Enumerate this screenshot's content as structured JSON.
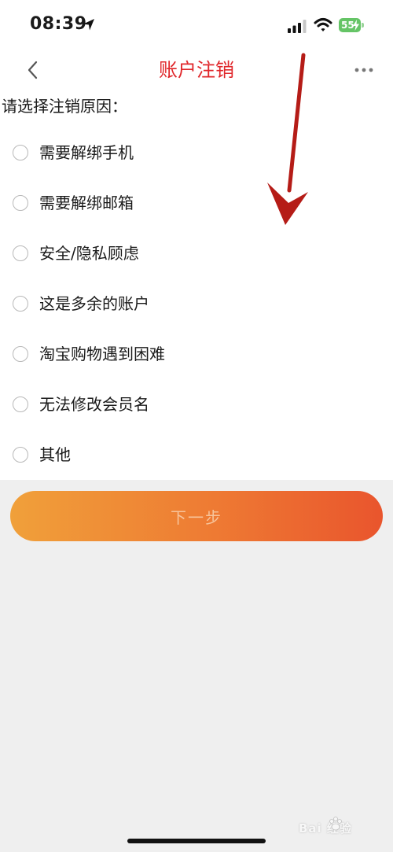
{
  "status_bar": {
    "time": "08:39",
    "battery": "55",
    "icons": [
      "location-arrow-icon",
      "signal-icon",
      "wifi-icon",
      "battery-icon",
      "charging-bolt-icon"
    ]
  },
  "nav": {
    "title": "账户注销",
    "back_icon": "chevron-left-icon",
    "more_icon": "more-dots-icon"
  },
  "prompt": "请选择注销原因：",
  "options": [
    {
      "label": "需要解绑手机",
      "selected": false
    },
    {
      "label": "需要解绑邮箱",
      "selected": false
    },
    {
      "label": "安全/隐私顾虑",
      "selected": false
    },
    {
      "label": "这是多余的账户",
      "selected": false
    },
    {
      "label": "淘宝购物遇到困难",
      "selected": false
    },
    {
      "label": "无法修改会员名",
      "selected": false
    },
    {
      "label": "其他",
      "selected": false
    }
  ],
  "next_button": {
    "label": "下一步",
    "enabled": false
  },
  "annotation": {
    "type": "red-arrow-down"
  },
  "watermark": {
    "text": "Bai 经验"
  },
  "colors": {
    "title_red": "#e0262a",
    "button_start": "#f0a03a",
    "button_end": "#e9552d",
    "battery_green": "#65c466",
    "background": "#efefef",
    "annotation_red": "#b51c17"
  }
}
